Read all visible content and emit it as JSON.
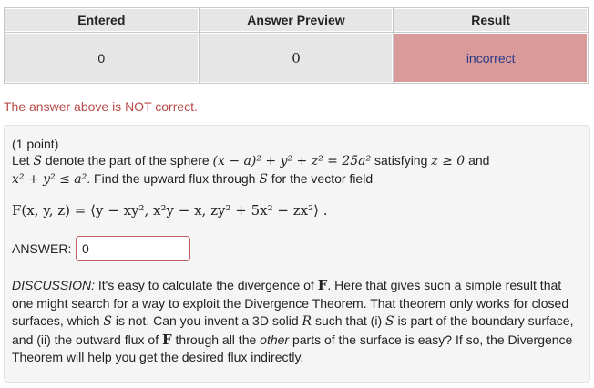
{
  "results": {
    "headers": [
      "Entered",
      "Answer Preview",
      "Result"
    ],
    "entered": "0",
    "preview": "0",
    "result": "incorrect"
  },
  "status_message": "The answer above is NOT correct.",
  "problem": {
    "points": "(1 point)",
    "line1_a": "Let ",
    "S": "S",
    "line1_b": " denote the part of the sphere ",
    "sphere_eq": "(x − a)² + y² + z² = 25a²",
    "line1_c": " satisfying ",
    "z_cond": "z ≥ 0",
    "line1_d": " and",
    "disk_eq": "x² + y² ≤ a²",
    "line2_a": ". Find the upward flux through ",
    "line2_b": " for the vector field",
    "field_eq": "F(x, y, z) = ⟨y − xy², x²y − x, zy² + 5x² − zx²⟩ .",
    "answer_label": "ANSWER:",
    "answer_value": "0",
    "discussion": {
      "d1": "DISCUSSION:",
      "d2": " It's easy to calculate the divergence of ",
      "F": "F",
      "d3": ". Here that gives such a simple result that one might search for a way to exploit the Divergence Theorem. That theorem only works for closed surfaces, which ",
      "d4": " is not. Can you invent a 3D solid ",
      "R": "R",
      "d5": " such that (i) ",
      "d6": " is part of the boundary surface, and (ii) the outward flux of ",
      "d7": " through all the ",
      "other": "other",
      "d8": " parts of the surface is easy? If so, the Divergence Theorem will help you get the desired flux indirectly."
    }
  }
}
